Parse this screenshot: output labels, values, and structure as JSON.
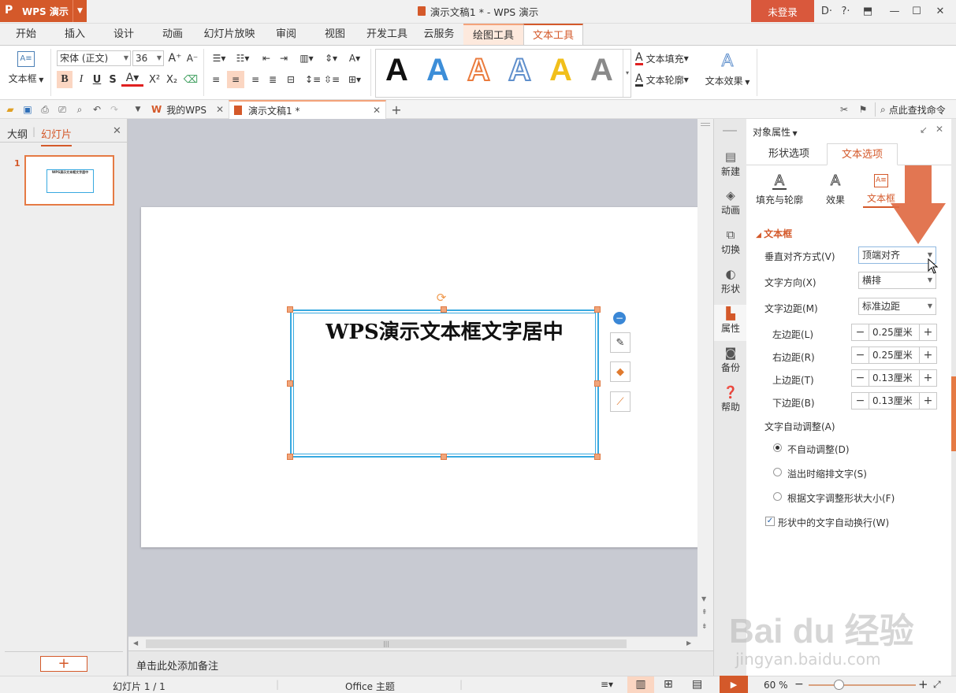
{
  "app": {
    "name": "WPS 演示",
    "doc_title": "演示文稿1 * - WPS 演示",
    "login": "未登录"
  },
  "menu": {
    "tabs": [
      "开始",
      "插入",
      "设计",
      "动画",
      "幻灯片放映",
      "审阅",
      "视图",
      "开发工具",
      "云服务",
      "绘图工具",
      "文本工具"
    ],
    "active": "文本工具"
  },
  "ribbon": {
    "textbox_label": "文本框",
    "font_name": "宋体 (正文)",
    "font_size": "36",
    "text_fill": "文本填充",
    "text_outline": "文本轮廓",
    "text_effect": "文本效果"
  },
  "quickbar": {
    "tabs": [
      {
        "label": "我的WPS"
      },
      {
        "label": "演示文稿1 *"
      }
    ],
    "search": "点此查找命令"
  },
  "left_panel": {
    "tab_outline": "大纲",
    "tab_slides": "幻灯片",
    "slide_number": "1"
  },
  "slide": {
    "text": "WPS演示文本框文字居中"
  },
  "notes": {
    "placeholder": "单击此处添加备注"
  },
  "sidestrip": [
    {
      "label": "新建",
      "icon": "new-icon"
    },
    {
      "label": "动画",
      "icon": "animation-icon"
    },
    {
      "label": "切换",
      "icon": "transition-icon"
    },
    {
      "label": "形状",
      "icon": "shape-icon"
    },
    {
      "label": "属性",
      "icon": "property-icon"
    },
    {
      "label": "备份",
      "icon": "backup-icon"
    },
    {
      "label": "帮助",
      "icon": "help-icon"
    }
  ],
  "props": {
    "header": "对象属性",
    "tabs": [
      "形状选项",
      "文本选项"
    ],
    "subtabs": [
      "填充与轮廓",
      "效果",
      "文本框"
    ],
    "section": "文本框",
    "valign_label": "垂直对齐方式(V)",
    "valign_value": "顶端对齐",
    "dir_label": "文字方向(X)",
    "dir_value": "横排",
    "margin_label": "文字边距(M)",
    "margin_value": "标准边距",
    "margins": [
      {
        "label": "左边距(L)",
        "value": "0.25厘米"
      },
      {
        "label": "右边距(R)",
        "value": "0.25厘米"
      },
      {
        "label": "上边距(T)",
        "value": "0.13厘米"
      },
      {
        "label": "下边距(B)",
        "value": "0.13厘米"
      }
    ],
    "autofit_label": "文字自动调整(A)",
    "autofit_options": [
      "不自动调整(D)",
      "溢出时缩排文字(S)",
      "根据文字调整形状大小(F)"
    ],
    "wrap_label": "形状中的文字自动换行(W)"
  },
  "status": {
    "slide": "幻灯片 1 / 1",
    "theme": "Office 主题",
    "zoom": "60 %"
  },
  "watermark": {
    "brand": "Bai du 经验",
    "url": "jingyan.baidu.com"
  },
  "colors": {
    "accent": "#d4592a",
    "selection": "#38a9e0"
  }
}
